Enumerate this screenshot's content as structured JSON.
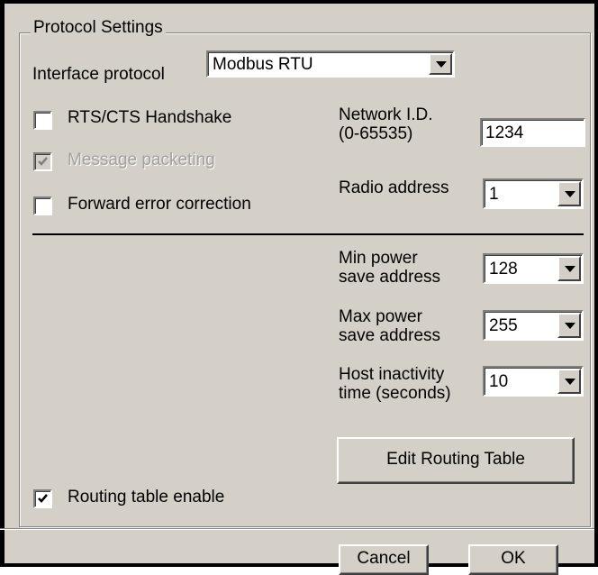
{
  "group": {
    "title": "Protocol Settings"
  },
  "interface_protocol": {
    "label": "Interface protocol",
    "value": "Modbus RTU"
  },
  "checkboxes": {
    "rts_cts": {
      "label": "RTS/CTS Handshake",
      "checked": false,
      "enabled": true
    },
    "message_packeting": {
      "label": "Message packeting",
      "checked": true,
      "enabled": false
    },
    "forward_error": {
      "label": "Forward error correction",
      "checked": false,
      "enabled": true
    },
    "routing_table": {
      "label": "Routing table enable",
      "checked": true,
      "enabled": true
    }
  },
  "network_id": {
    "label_line1": "Network I.D.",
    "label_line2": "(0-65535)",
    "value": "1234"
  },
  "radio_address": {
    "label": "Radio address",
    "value": "1"
  },
  "min_power": {
    "label_line1": "Min power",
    "label_line2": "save address",
    "value": "128"
  },
  "max_power": {
    "label_line1": "Max power",
    "label_line2": "save address",
    "value": "255"
  },
  "host_inactivity": {
    "label_line1": "Host inactivity",
    "label_line2": "time (seconds)",
    "value": "10"
  },
  "buttons": {
    "edit_routing": "Edit Routing Table",
    "cancel": "Cancel",
    "ok": "OK"
  },
  "icons": {
    "combo_arrow": "chevron-down-icon",
    "check": "check-icon"
  },
  "colors": {
    "face": "#d4d0c8",
    "shadow": "#808080",
    "field": "#ffffff"
  }
}
